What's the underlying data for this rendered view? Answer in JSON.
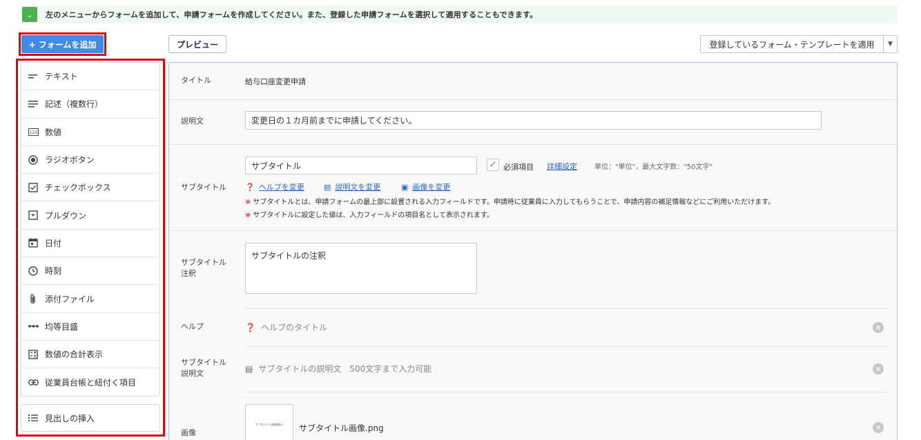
{
  "info": {
    "text": "左のメニューからフォームを追加して、申請フォームを作成してください。また、登録した申請フォームを選択して適用することもできます。"
  },
  "toolbar": {
    "add_form": "+ フォームを追加",
    "preview": "プレビュー",
    "template_select": "登録しているフォーム・テンプレートを適用"
  },
  "menu": {
    "items": [
      {
        "label": "テキスト",
        "icon": "short-text-icon"
      },
      {
        "label": "記述（複数行）",
        "icon": "long-text-icon"
      },
      {
        "label": "数値",
        "icon": "number-icon"
      },
      {
        "label": "ラジオボタン",
        "icon": "radio-icon"
      },
      {
        "label": "チェックボックス",
        "icon": "checkbox-icon"
      },
      {
        "label": "プルダウン",
        "icon": "dropdown-icon"
      },
      {
        "label": "日付",
        "icon": "calendar-icon"
      },
      {
        "label": "時刻",
        "icon": "clock-icon"
      },
      {
        "label": "添付ファイル",
        "icon": "attachment-icon"
      },
      {
        "label": "均等目盛",
        "icon": "scale-icon"
      },
      {
        "label": "数値の合計表示",
        "icon": "calculator-icon"
      },
      {
        "label": "従業員台帳と紐付く項目",
        "icon": "link-icon"
      }
    ],
    "heading_insert": "見出しの挿入"
  },
  "form": {
    "title_label": "タイトル",
    "title_value": "給与口座変更申請",
    "description_label": "説明文",
    "description_value": "変更日の１カ月前までに申請してください。",
    "subtitle_label": "サブタイトル",
    "subtitle_value": "サブタイトル",
    "required_label": "必須項目",
    "detail_settings": "詳細設定",
    "unit_note": "単位：\"単位\"，最大文字数：\"50文字\"",
    "change_help": "ヘルプを変更",
    "change_description": "説明文を変更",
    "change_image": "画像を変更",
    "warn_mark": "※",
    "warn_1": "サブタイトルとは、申請フォームの最上部に設置される入力フィールドです。申請時に従業員に入力してもらうことで、申請内容の補足情報などにご利用いただけます。",
    "warn_2": "サブタイトルに設定した値は、入力フィールドの項目名として表示されます。",
    "annotation_label_1": "サブタイトル",
    "annotation_label_2": "注釈",
    "annotation_value": "サブタイトルの注釈",
    "help_label": "ヘルプ",
    "help_placeholder": "ヘルプのタイトル",
    "subdesc_label_1": "サブタイトル",
    "subdesc_label_2": "説明文",
    "subdesc_placeholder": "サブタイトルの説明文　500文字まで入力可能",
    "image_label": "画像",
    "image_thumb_text": "サブタイトル画像表示",
    "image_filename": "サブタイトル画像.png"
  },
  "colors": {
    "accent_blue": "#3f8be6",
    "highlight_red": "#e0000f",
    "success_green": "#4caf50",
    "link_blue": "#2c63c5"
  }
}
